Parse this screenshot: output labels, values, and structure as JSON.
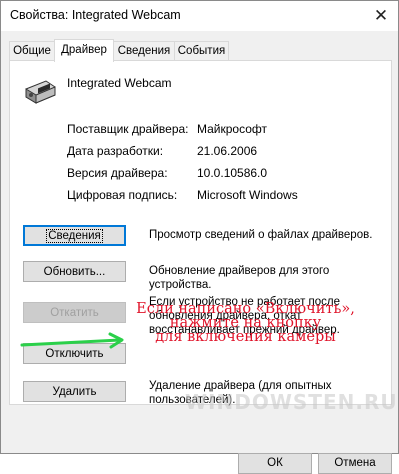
{
  "window": {
    "title": "Свойства: Integrated Webcam",
    "close_glyph": "✕"
  },
  "tabs": [
    {
      "label": "Общие"
    },
    {
      "label": "Драйвер"
    },
    {
      "label": "Сведения"
    },
    {
      "label": "События"
    }
  ],
  "device": {
    "name": "Integrated Webcam",
    "icon": "webcam-icon"
  },
  "properties": [
    {
      "label": "Поставщик драйвера:",
      "value": "Майкрософт"
    },
    {
      "label": "Дата разработки:",
      "value": "21.06.2006"
    },
    {
      "label": "Версия драйвера:",
      "value": "10.0.10586.0"
    },
    {
      "label": "Цифровая подпись:",
      "value": "Microsoft Windows"
    }
  ],
  "actions": [
    {
      "button": "Сведения",
      "description": "Просмотр сведений о файлах драйверов."
    },
    {
      "button": "Обновить...",
      "description": "Обновление драйверов для этого устройства."
    },
    {
      "button": "Откатить",
      "description": "Если устройство не работает после обновления драйвера, откат восстанавливает прежний драйвер."
    },
    {
      "button": "Отключить",
      "description": ""
    },
    {
      "button": "Удалить",
      "description": "Удаление драйвера (для опытных пользователей)."
    }
  ],
  "annotation": {
    "line1": "Если написано «Включить»,",
    "line2": "нажмите на кнопку",
    "line3": "для включения камеры",
    "color": "#e0142a",
    "arrow_color": "#2bd04a"
  },
  "watermark": "WINDOWSTEN.RU",
  "footer": {
    "ok": "ОК",
    "cancel": "Отмена"
  }
}
